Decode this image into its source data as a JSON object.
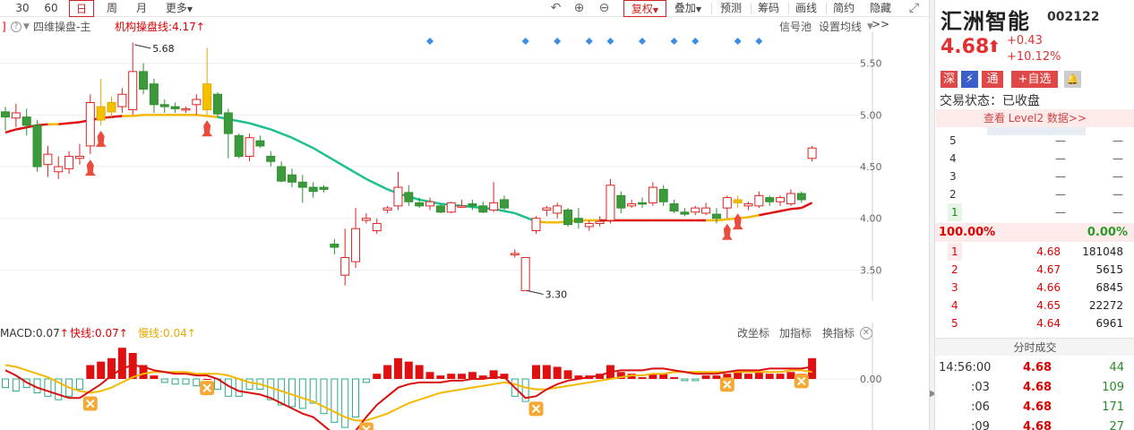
{
  "toolbar": {
    "periods": [
      "30",
      "60",
      "日",
      "周",
      "月"
    ],
    "more": "更多",
    "fq": "复权",
    "overlay": "叠加",
    "forecast": "预测",
    "chips": "筹码",
    "draw": "画线",
    "simple": "简约",
    "hide": "隐藏>>"
  },
  "chart_header": {
    "bracket": "]",
    "help": "?",
    "indicator": "四维操盘-主",
    "line_label": "机构操盘线:4.17",
    "signal_pool": "信号池",
    "set_ma": "设置均线"
  },
  "macd_header": {
    "macd": "MACD:0.07",
    "fast": "快线:0.07",
    "slow": "慢线:0.04",
    "coord": "改坐标",
    "add_ind": "加指标",
    "swap_ind": "换指标"
  },
  "stock": {
    "name": "汇洲智能",
    "code": "002122",
    "price": "4.68",
    "change": "+0.43",
    "change_pct": "+10.12%",
    "tags": [
      "深",
      "⚡",
      "通",
      "+自选"
    ],
    "status": "交易状态：已收盘",
    "level2": "查看 Level2 数据>>"
  },
  "asks": [
    {
      "label": "5",
      "price": "—",
      "vol": "—"
    },
    {
      "label": "4",
      "price": "—",
      "vol": "—"
    },
    {
      "label": "3",
      "price": "—",
      "vol": "—"
    },
    {
      "label": "2",
      "price": "—",
      "vol": "—"
    },
    {
      "label": "1",
      "price": "—",
      "vol": "—"
    }
  ],
  "ratio": {
    "left": "100.00%",
    "right": "0.00%"
  },
  "bids": [
    {
      "label": "1",
      "price": "4.68",
      "vol": "181048"
    },
    {
      "label": "2",
      "price": "4.67",
      "vol": "5615"
    },
    {
      "label": "3",
      "price": "4.66",
      "vol": "6845"
    },
    {
      "label": "4",
      "price": "4.65",
      "vol": "22272"
    },
    {
      "label": "5",
      "price": "4.64",
      "vol": "6961"
    }
  ],
  "trades_title": "分时成交",
  "trades": [
    {
      "time": "14:56:00",
      "price": "4.68",
      "vol": "44"
    },
    {
      "time": ":03",
      "price": "4.68",
      "vol": "109"
    },
    {
      "time": ":06",
      "price": "4.68",
      "vol": "171"
    },
    {
      "time": ":09",
      "price": "4.68",
      "vol": "27"
    }
  ],
  "chart_data": [
    {
      "type": "candlestick",
      "ylim": [
        3.2,
        5.8
      ],
      "y_ticks": [
        "5.50",
        "5.00",
        "4.50",
        "4.00",
        "3.50"
      ],
      "annotations": [
        {
          "label": "5.68",
          "value": 5.68
        },
        {
          "label": "3.30",
          "value": 3.3
        }
      ],
      "candles": [
        [
          5.03,
          5.08,
          4.85,
          4.98
        ],
        [
          4.97,
          5.11,
          4.88,
          5.02
        ],
        [
          4.98,
          5.06,
          4.8,
          4.9
        ],
        [
          4.9,
          4.95,
          4.45,
          4.5
        ],
        [
          4.52,
          4.7,
          4.4,
          4.62
        ],
        [
          4.45,
          4.6,
          4.38,
          4.5
        ],
        [
          4.48,
          4.65,
          4.43,
          4.6
        ],
        [
          4.58,
          4.72,
          4.52,
          4.6
        ],
        [
          4.7,
          5.2,
          4.62,
          5.12
        ],
        [
          4.95,
          5.35,
          4.9,
          5.08
        ],
        [
          5.03,
          5.18,
          4.98,
          5.12
        ],
        [
          5.08,
          5.26,
          5.02,
          5.2
        ],
        [
          5.05,
          5.7,
          5.0,
          5.42
        ],
        [
          5.42,
          5.5,
          5.2,
          5.25
        ],
        [
          5.3,
          5.35,
          5.02,
          5.1
        ],
        [
          5.1,
          5.15,
          5.02,
          5.08
        ],
        [
          5.08,
          5.12,
          5.02,
          5.06
        ],
        [
          5.05,
          5.08,
          5.02,
          5.06
        ],
        [
          5.1,
          5.2,
          5.0,
          5.15
        ],
        [
          5.05,
          5.65,
          5.0,
          5.3
        ],
        [
          5.2,
          5.22,
          4.98,
          5.01
        ],
        [
          5.02,
          5.06,
          4.58,
          4.82
        ],
        [
          4.8,
          4.82,
          4.58,
          4.6
        ],
        [
          4.6,
          4.82,
          4.55,
          4.78
        ],
        [
          4.75,
          4.8,
          4.68,
          4.7
        ],
        [
          4.6,
          4.65,
          4.5,
          4.55
        ],
        [
          4.5,
          4.55,
          4.35,
          4.36
        ],
        [
          4.42,
          4.48,
          4.3,
          4.35
        ],
        [
          4.35,
          4.42,
          4.15,
          4.3
        ],
        [
          4.3,
          4.35,
          4.2,
          4.26
        ],
        [
          4.3,
          4.32,
          4.25,
          4.28
        ],
        [
          3.75,
          3.8,
          3.65,
          3.72
        ],
        [
          3.45,
          3.9,
          3.35,
          3.62
        ],
        [
          3.58,
          4.1,
          3.52,
          3.9
        ],
        [
          3.98,
          4.05,
          3.95,
          4.0
        ],
        [
          3.88,
          4.0,
          3.85,
          3.95
        ],
        [
          4.08,
          4.12,
          4.05,
          4.1
        ],
        [
          4.12,
          4.45,
          4.08,
          4.3
        ],
        [
          4.25,
          4.32,
          4.12,
          4.16
        ],
        [
          4.15,
          4.2,
          4.1,
          4.12
        ],
        [
          4.12,
          4.2,
          4.08,
          4.16
        ],
        [
          4.12,
          4.14,
          4.05,
          4.06
        ],
        [
          4.06,
          4.16,
          4.05,
          4.15
        ],
        [
          4.12,
          4.18,
          4.1,
          4.12
        ],
        [
          4.14,
          4.18,
          4.08,
          4.12
        ],
        [
          4.12,
          4.16,
          4.05,
          4.06
        ],
        [
          4.08,
          4.35,
          4.06,
          4.15
        ],
        [
          4.18,
          4.22,
          4.08,
          4.1
        ],
        [
          3.65,
          3.7,
          3.62,
          3.66
        ],
        [
          3.3,
          3.62,
          3.3,
          3.62
        ],
        [
          3.88,
          4.02,
          3.85,
          4.0
        ],
        [
          4.08,
          4.12,
          4.02,
          4.1
        ],
        [
          4.05,
          4.15,
          4.0,
          4.12
        ],
        [
          4.08,
          4.1,
          3.92,
          3.94
        ],
        [
          4.0,
          4.1,
          3.9,
          3.96
        ],
        [
          3.92,
          3.98,
          3.88,
          3.95
        ],
        [
          3.95,
          4.02,
          3.92,
          3.97
        ],
        [
          3.98,
          4.38,
          3.95,
          4.32
        ],
        [
          4.22,
          4.26,
          4.05,
          4.1
        ],
        [
          4.12,
          4.18,
          4.1,
          4.14
        ],
        [
          4.15,
          4.2,
          4.1,
          4.14
        ],
        [
          4.15,
          4.35,
          4.12,
          4.3
        ],
        [
          4.28,
          4.32,
          4.12,
          4.16
        ],
        [
          4.14,
          4.18,
          4.05,
          4.07
        ],
        [
          4.06,
          4.1,
          4.02,
          4.04
        ],
        [
          4.06,
          4.12,
          4.03,
          4.1
        ],
        [
          4.05,
          4.15,
          4.03,
          4.1
        ],
        [
          4.04,
          4.1,
          3.95,
          4.0
        ],
        [
          4.1,
          4.22,
          4.0,
          4.2
        ],
        [
          4.15,
          4.22,
          4.1,
          4.18
        ],
        [
          4.12,
          4.16,
          4.08,
          4.14
        ],
        [
          4.12,
          4.26,
          4.1,
          4.22
        ],
        [
          4.2,
          4.22,
          4.12,
          4.16
        ],
        [
          4.16,
          4.22,
          4.12,
          4.2
        ],
        [
          4.14,
          4.28,
          4.12,
          4.24
        ],
        [
          4.24,
          4.26,
          4.15,
          4.18
        ],
        [
          4.58,
          4.7,
          4.55,
          4.68
        ]
      ],
      "ma_line": [
        4.83,
        4.86,
        4.88,
        4.9,
        4.91,
        4.91,
        4.92,
        4.93,
        4.95,
        4.97,
        4.98,
        4.99,
        4.99,
        5.0,
        5.0,
        5.0,
        5.0,
        5.0,
        5.0,
        4.99,
        4.98,
        4.96,
        4.94,
        4.92,
        4.89,
        4.86,
        4.82,
        4.78,
        4.73,
        4.68,
        4.62,
        4.56,
        4.5,
        4.44,
        4.38,
        4.33,
        4.28,
        4.24,
        4.21,
        4.18,
        4.16,
        4.14,
        4.13,
        4.12,
        4.11,
        4.1,
        4.09,
        4.07,
        4.05,
        4.01,
        3.97,
        3.96,
        3.96,
        3.97,
        3.98,
        3.98,
        3.98,
        3.98,
        3.98,
        3.98,
        3.98,
        3.98,
        3.98,
        3.98,
        3.98,
        3.98,
        3.98,
        3.98,
        3.99,
        4.0,
        4.01,
        4.03,
        4.05,
        4.07,
        4.09,
        4.1,
        4.15
      ],
      "signal_days": [
        0,
        1,
        7,
        10,
        12,
        13,
        18,
        19,
        20,
        24,
        25,
        26,
        28,
        30,
        31,
        32,
        33
      ],
      "top_markers": [
        40,
        49,
        52,
        55,
        57,
        60,
        63,
        65,
        69,
        71
      ],
      "rocket_days": [
        8,
        9,
        19,
        68,
        69
      ]
    },
    {
      "type": "bar",
      "name": "MACD",
      "y_ticks": [
        "0.00"
      ],
      "hist": [
        -0.05,
        -0.07,
        -0.05,
        -0.08,
        -0.1,
        -0.12,
        -0.1,
        -0.06,
        0.08,
        0.1,
        0.12,
        0.18,
        0.15,
        0.08,
        0.02,
        -0.02,
        -0.03,
        -0.03,
        -0.04,
        0.0,
        -0.06,
        -0.1,
        -0.1,
        -0.06,
        -0.06,
        -0.12,
        -0.15,
        -0.16,
        -0.17,
        -0.14,
        -0.2,
        -0.25,
        -0.28,
        -0.22,
        -0.02,
        0.03,
        0.08,
        0.12,
        0.1,
        0.08,
        0.04,
        0.02,
        0.03,
        0.03,
        0.04,
        0.02,
        0.05,
        0.03,
        -0.1,
        -0.13,
        0.08,
        0.08,
        0.07,
        0.05,
        0.02,
        0.02,
        0.03,
        0.08,
        0.04,
        0.03,
        0.01,
        0.03,
        0.03,
        0.01,
        -0.01,
        -0.01,
        0.02,
        0.02,
        0.03,
        0.04,
        0.03,
        0.04,
        0.03,
        0.03,
        0.04,
        0.03,
        0.12
      ],
      "fast": [
        0.05,
        0.02,
        -0.02,
        -0.05,
        -0.07,
        -0.09,
        -0.11,
        -0.11,
        -0.07,
        -0.03,
        0.02,
        0.06,
        0.08,
        0.07,
        0.05,
        0.04,
        0.03,
        0.03,
        0.02,
        0.02,
        0.0,
        -0.04,
        -0.07,
        -0.08,
        -0.09,
        -0.11,
        -0.14,
        -0.17,
        -0.2,
        -0.22,
        -0.27,
        -0.32,
        -0.35,
        -0.3,
        -0.22,
        -0.15,
        -0.1,
        -0.05,
        -0.03,
        -0.02,
        -0.02,
        -0.02,
        -0.01,
        -0.01,
        0.0,
        0.0,
        0.01,
        0.01,
        -0.05,
        -0.11,
        -0.1,
        -0.06,
        -0.03,
        -0.01,
        0.0,
        0.01,
        0.02,
        0.04,
        0.05,
        0.05,
        0.05,
        0.06,
        0.06,
        0.05,
        0.04,
        0.03,
        0.03,
        0.03,
        0.04,
        0.05,
        0.05,
        0.05,
        0.06,
        0.06,
        0.06,
        0.06,
        0.07
      ],
      "slow": [
        0.08,
        0.07,
        0.05,
        0.03,
        0.01,
        -0.02,
        -0.05,
        -0.07,
        -0.08,
        -0.07,
        -0.05,
        -0.02,
        0.01,
        0.03,
        0.04,
        0.04,
        0.04,
        0.04,
        0.03,
        0.03,
        0.03,
        0.02,
        0.0,
        -0.02,
        -0.03,
        -0.05,
        -0.07,
        -0.09,
        -0.11,
        -0.13,
        -0.16,
        -0.19,
        -0.22,
        -0.24,
        -0.24,
        -0.22,
        -0.2,
        -0.17,
        -0.14,
        -0.12,
        -0.1,
        -0.08,
        -0.07,
        -0.06,
        -0.05,
        -0.04,
        -0.03,
        -0.02,
        -0.03,
        -0.05,
        -0.06,
        -0.06,
        -0.05,
        -0.04,
        -0.03,
        -0.02,
        -0.01,
        0.0,
        0.01,
        0.02,
        0.02,
        0.03,
        0.03,
        0.04,
        0.04,
        0.04,
        0.04,
        0.04,
        0.04,
        0.04,
        0.04,
        0.04,
        0.04,
        0.04,
        0.05,
        0.05,
        0.04
      ],
      "cross_days": [
        8,
        19,
        34,
        50,
        68,
        75
      ]
    }
  ]
}
